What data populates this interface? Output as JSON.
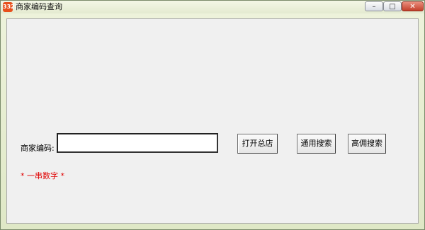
{
  "window": {
    "title": "商家编码查询",
    "app_icon_text": "3322",
    "controls": {
      "minimize": "–",
      "maximize": "□",
      "close": "✕"
    }
  },
  "form": {
    "merchant_code_label": "商家编码:",
    "merchant_code_value": "",
    "hint_prefix": "*",
    "hint_text": "一串数字",
    "hint_suffix": "*"
  },
  "buttons": {
    "open_store": "打开总店",
    "common_search": "通用搜索",
    "advanced_search": "高佣搜索"
  },
  "colors": {
    "hint": "#e00000",
    "client_bg": "#f0f0f0"
  }
}
